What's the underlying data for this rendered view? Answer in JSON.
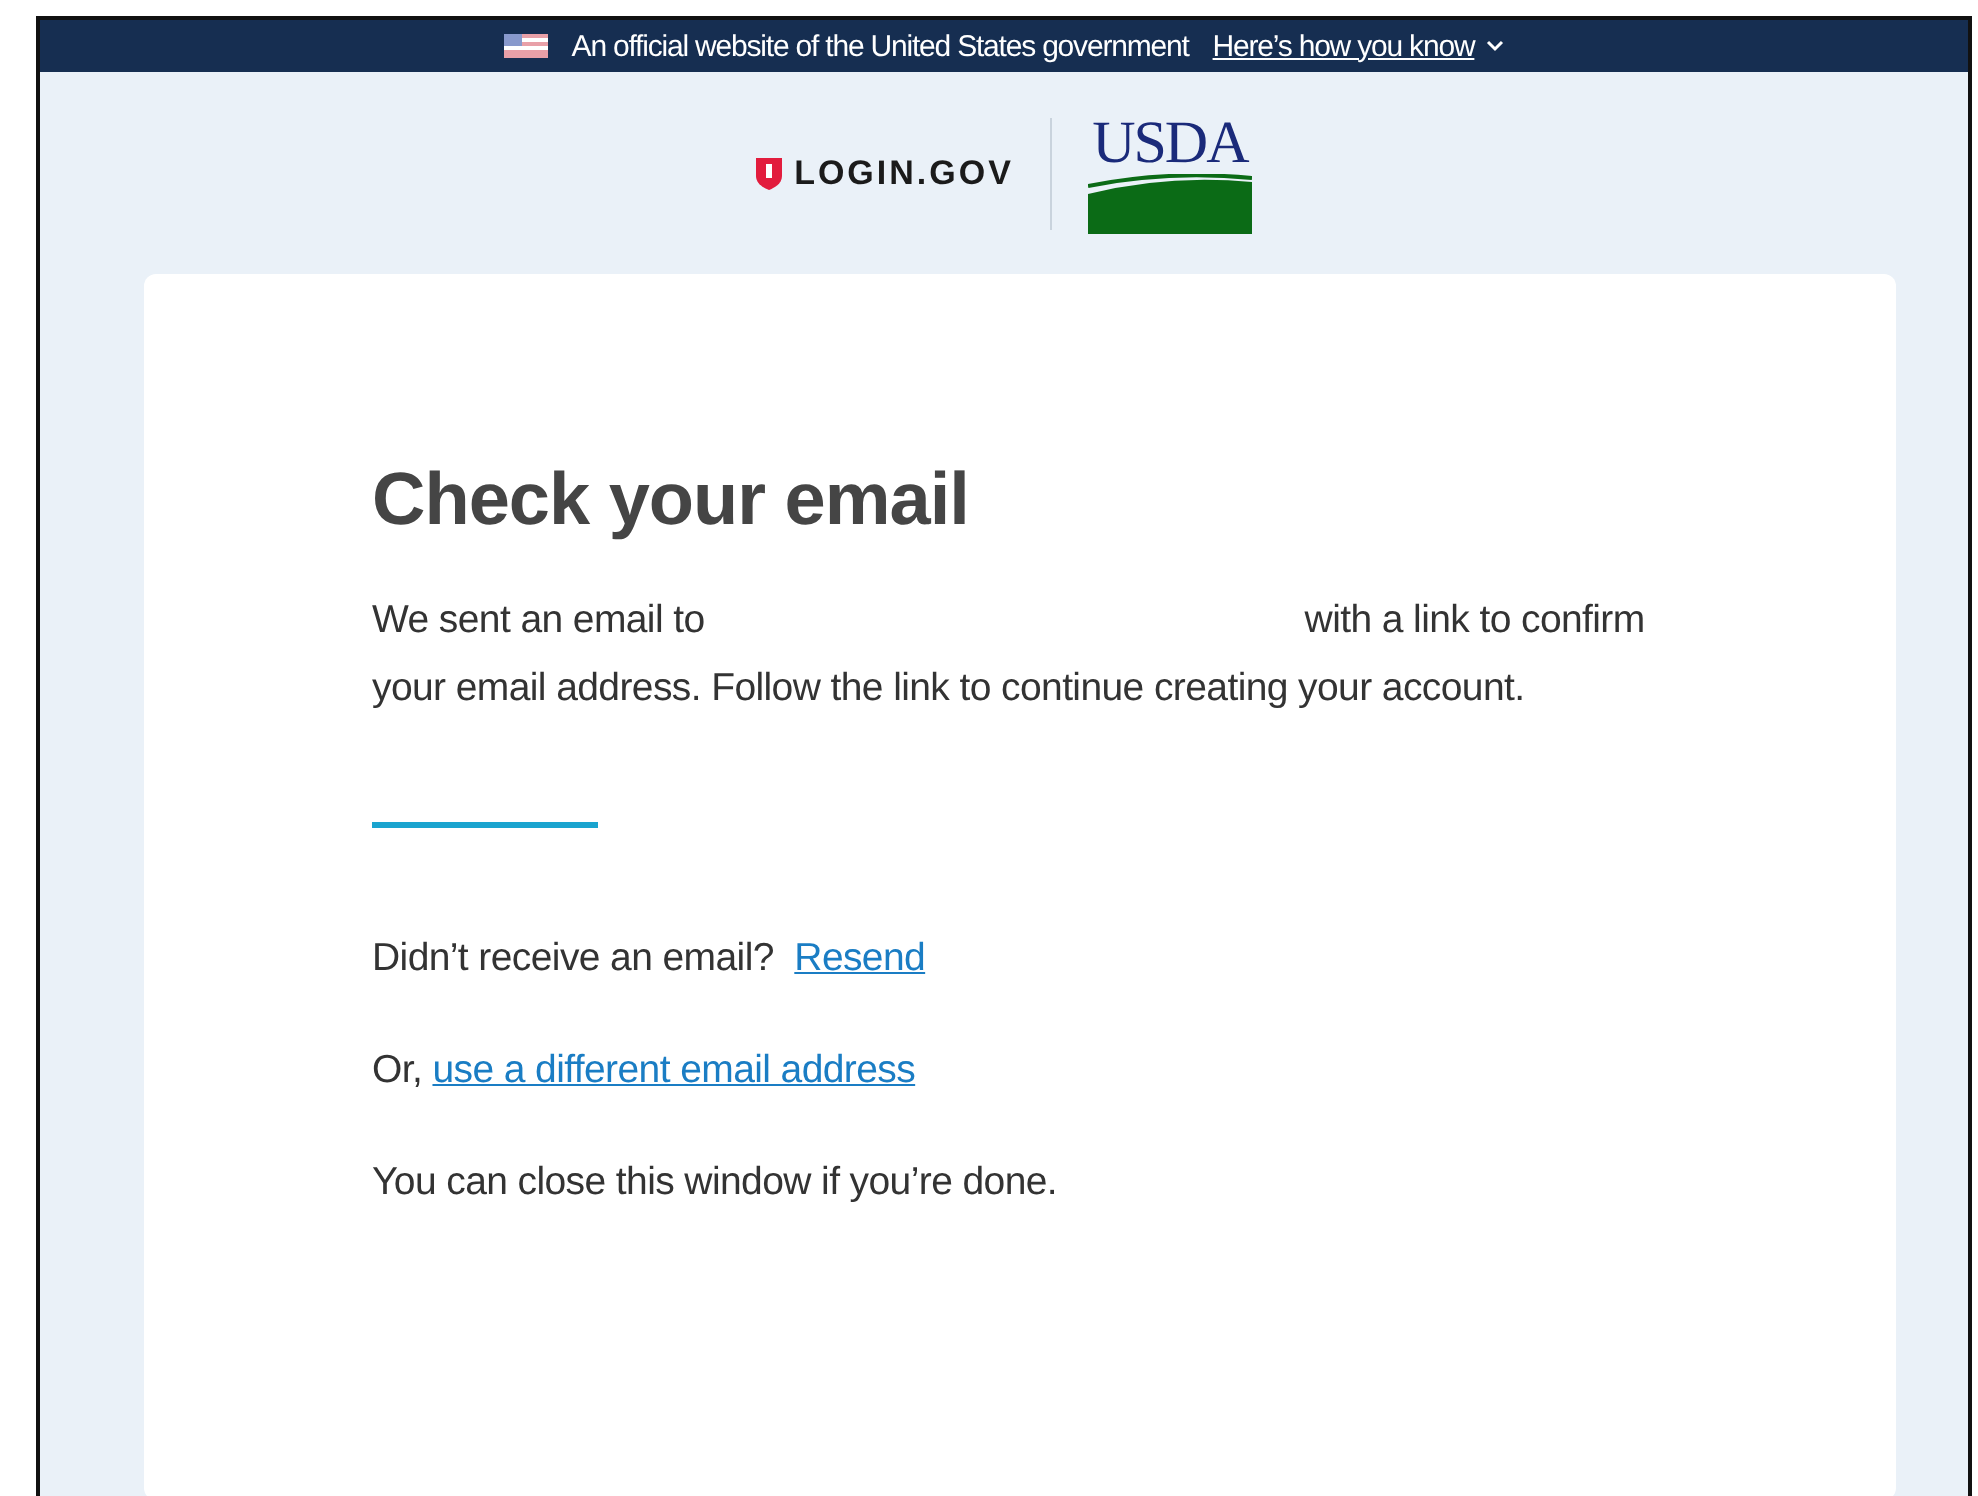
{
  "banner": {
    "text": "An official website of the United States government",
    "link": "Here’s how you know"
  },
  "header": {
    "login_logo": "LOGIN.GOV",
    "agency_logo": "USDA"
  },
  "card": {
    "title": "Check your email",
    "message_before": "We sent an email to",
    "message_after": "with a link to confirm your email address. Follow the link to continue creating your account.",
    "resend_prompt": "Didn’t receive an email?",
    "resend_link": "Resend",
    "alt_prefix": "Or,",
    "alt_link": "use a different email address",
    "close_note": "You can close this window if you’re done."
  }
}
